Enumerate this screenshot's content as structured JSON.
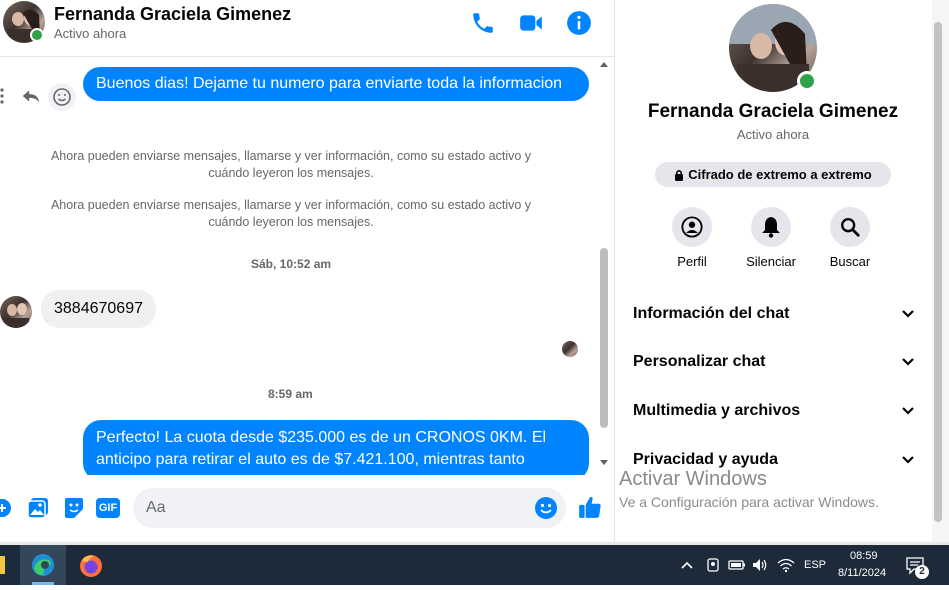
{
  "header": {
    "name": "Fernanda Graciela Gimenez",
    "status": "Activo ahora"
  },
  "messages": {
    "outgoing_1": "Buenos dias! Dejame tu numero para enviarte toda la informacion",
    "system_1": "Ahora pueden enviarse mensajes, llamarse y ver información, como su estado activo y cuándo leyeron los mensajes.",
    "system_2": "Ahora pueden enviarse mensajes, llamarse y ver información, como su estado activo y cuándo leyeron los mensajes.",
    "timestamp_1": "Sáb, 10:52 am",
    "incoming_1": "3884670697",
    "timestamp_2": "8:59 am",
    "outgoing_2": "Perfecto! La cuota desde $235.000 es de un CRONOS 0KM. El anticipo para retirar el auto es de $7.421.100, mientras tanto"
  },
  "composer": {
    "placeholder": "Aa",
    "gif_label": "GIF"
  },
  "profile": {
    "name": "Fernanda Graciela Gimenez",
    "status": "Activo ahora",
    "encryption_badge": "Cifrado de extremo a extremo",
    "actions": [
      {
        "label": "Perfil",
        "icon": "profile-icon"
      },
      {
        "label": "Silenciar",
        "icon": "bell-icon"
      },
      {
        "label": "Buscar",
        "icon": "search-icon"
      }
    ],
    "sections": [
      "Información del chat",
      "Personalizar chat",
      "Multimedia y archivos",
      "Privacidad y ayuda"
    ]
  },
  "watermark": {
    "title": "Activar Windows",
    "subtitle": "Ve a Configuración para activar Windows."
  },
  "taskbar": {
    "language": "ESP",
    "time": "08:59",
    "date": "8/11/2024",
    "notifications": "2"
  },
  "colors": {
    "accent": "#0084ff",
    "online": "#31a24c",
    "taskbar": "#1c2a3a"
  }
}
